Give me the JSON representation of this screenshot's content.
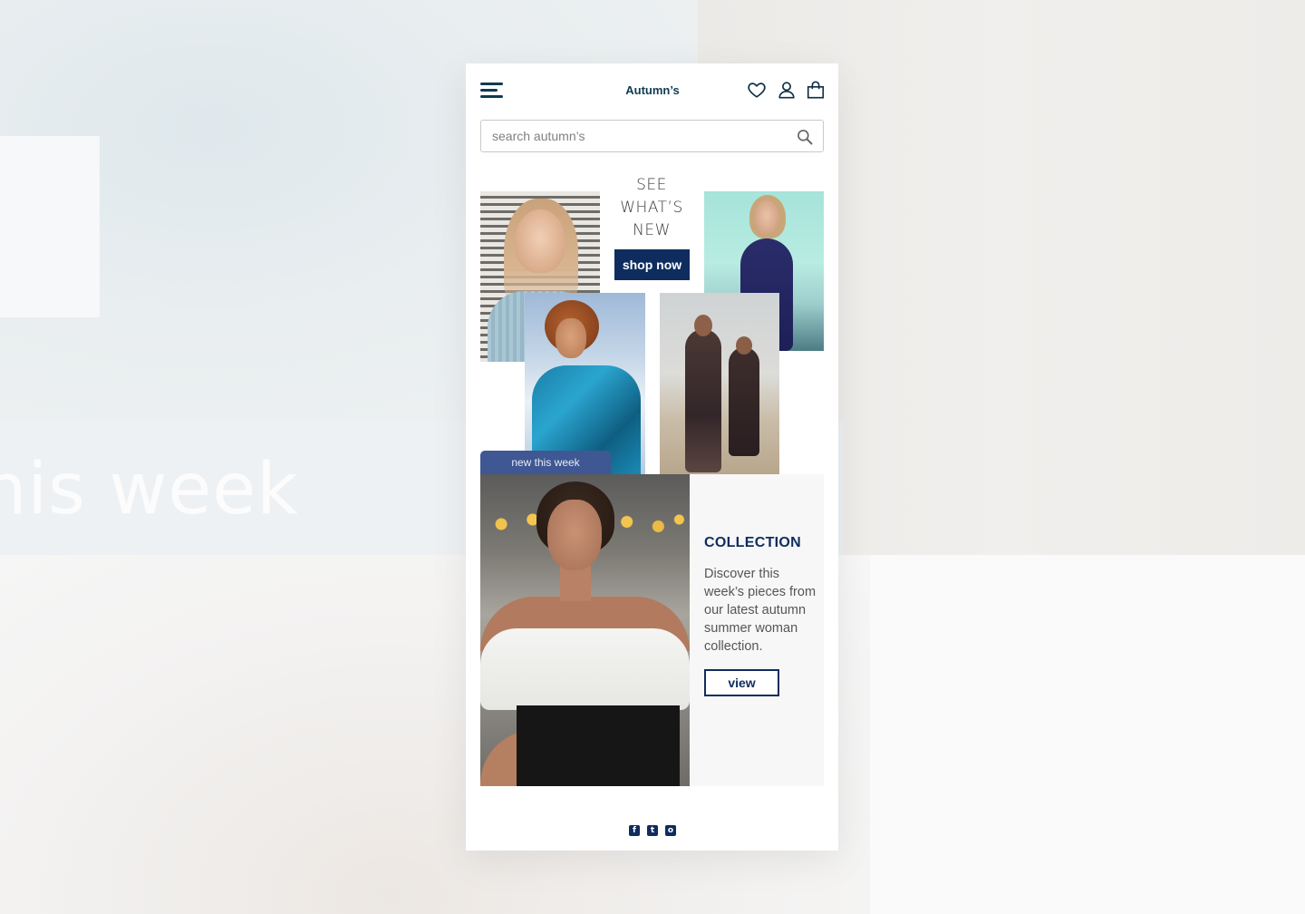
{
  "background": {
    "ghost_text": "his week"
  },
  "header": {
    "brand": "Autumn’s"
  },
  "search": {
    "placeholder": "search autumn’s"
  },
  "hero": {
    "line1": "SEE",
    "line2": "WHAT’S",
    "line3": "NEW",
    "shop_label": "shop now",
    "tab_label": "new this week"
  },
  "collection": {
    "title": "COLLECTION",
    "description": "Discover this week’s pieces from our latest autumn summer woman collection.",
    "view_label": "view"
  },
  "colors": {
    "accent": "#0e2d5e",
    "tab": "#3f5793",
    "brand": "#0d3b52"
  },
  "icons": {
    "menu": "hamburger-icon",
    "wishlist": "heart-icon",
    "account": "user-icon",
    "cart": "bag-icon",
    "search": "search-icon",
    "social": [
      "facebook-icon",
      "twitter-icon",
      "instagram-icon"
    ]
  }
}
